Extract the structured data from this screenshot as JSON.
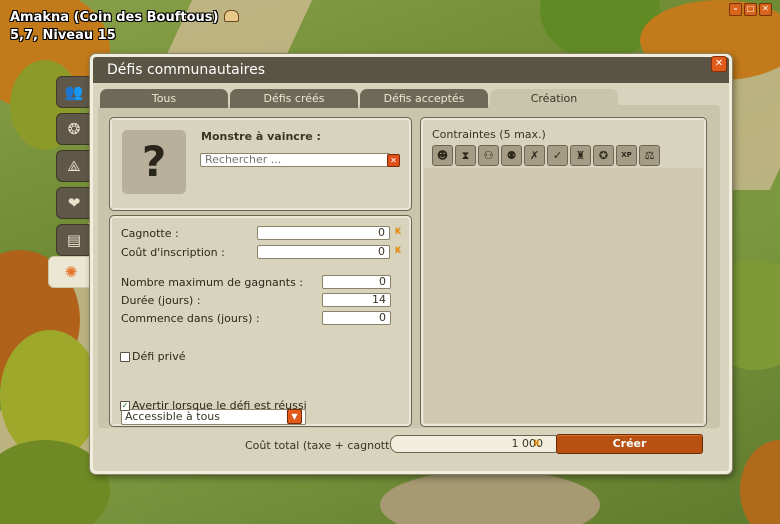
{
  "hud": {
    "location_line1": "Amakna (Coin des Bouftous)",
    "location_line2": "5,7, Niveau 15"
  },
  "side_tabs": [
    {
      "icon": "group-icon",
      "glyph": "👥"
    },
    {
      "icon": "guild-icon",
      "glyph": "❂"
    },
    {
      "icon": "alliance-icon",
      "glyph": "⟁"
    },
    {
      "icon": "heart-icon",
      "glyph": "❤"
    },
    {
      "icon": "book-icon",
      "glyph": "▤"
    },
    {
      "icon": "challenge-icon",
      "glyph": "✺"
    }
  ],
  "window": {
    "title": "Défis communautaires",
    "tabs": [
      "Tous",
      "Défis créés",
      "Défis acceptés",
      "Création"
    ],
    "active_tab": "Création"
  },
  "monster": {
    "title": "Monstre à vaincre :",
    "placeholder": "Rechercher ...",
    "unknown_glyph": "?"
  },
  "form": {
    "pot_label": "Cagnotte :",
    "pot_value": "0",
    "fee_label": "Coût d'inscription :",
    "fee_value": "0",
    "max_winners_label": "Nombre maximum de gagnants :",
    "max_winners_value": "0",
    "duration_label": "Durée (jours) :",
    "duration_value": "14",
    "starts_label": "Commence dans (jours) :",
    "starts_value": "0",
    "private_label": "Défi privé",
    "private_checked": false,
    "access_value": "Accessible à tous",
    "notify_label": "Avertir lorsque le défi est réussi",
    "notify_checked": true
  },
  "constraints": {
    "title": "Contraintes (5 max.)",
    "icons": [
      {
        "name": "mask-icon",
        "glyph": "☻"
      },
      {
        "name": "hourglass-icon",
        "glyph": "⧗"
      },
      {
        "name": "party-icon",
        "glyph": "⚇"
      },
      {
        "name": "party-size-icon",
        "glyph": "⚉"
      },
      {
        "name": "no-class-icon",
        "glyph": "✗"
      },
      {
        "name": "class-check-icon",
        "glyph": "✓"
      },
      {
        "name": "helmet-icon",
        "glyph": "♜"
      },
      {
        "name": "medal-icon",
        "glyph": "✪"
      },
      {
        "name": "xp-icon",
        "glyph": "XP"
      },
      {
        "name": "level-icon",
        "glyph": "⚖"
      }
    ]
  },
  "footer": {
    "total_label": "Coût total (taxe + cagnotte)",
    "total_value": "1 000",
    "create_label": "Créer"
  },
  "colors": {
    "accent": "#e05a1a",
    "title_bar": "#5a5444",
    "panel": "#d8d3bc",
    "create_button": "#b85012"
  }
}
